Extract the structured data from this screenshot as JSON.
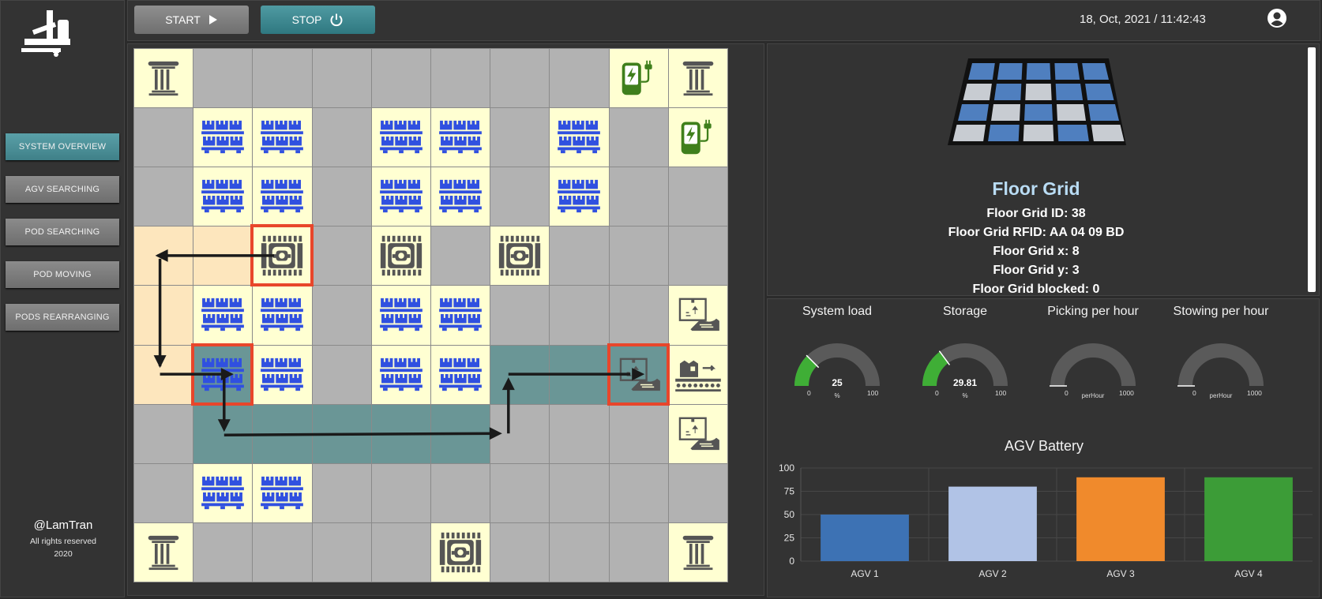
{
  "sidebar": {
    "nav": [
      "SYSTEM OVERVIEW",
      "AGV SEARCHING",
      "POD SEARCHING",
      "POD MOVING",
      "PODS REARRANGING"
    ],
    "active_index": 0,
    "author": "@LamTran",
    "rights": "All rights reserved",
    "year": "2020"
  },
  "topbar": {
    "start_label": "START",
    "stop_label": "STOP",
    "datetime": "18, Oct, 2021 / 11:42:43"
  },
  "floor_grid": {
    "cols": 10,
    "rows": 9,
    "cell_types": [
      [
        "pillar",
        "gray",
        "gray",
        "gray",
        "gray",
        "gray",
        "gray",
        "gray",
        "charger",
        "pillar"
      ],
      [
        "gray",
        "pod",
        "pod",
        "gray",
        "pod",
        "pod",
        "gray",
        "pod",
        "gray",
        "charger"
      ],
      [
        "gray",
        "pod",
        "pod",
        "gray",
        "pod",
        "pod",
        "gray",
        "pod",
        "gray",
        "gray"
      ],
      [
        "path-start",
        "path-start",
        "agv",
        "gray",
        "agv",
        "gray",
        "agv",
        "gray",
        "gray",
        "gray"
      ],
      [
        "path-start",
        "pod",
        "pod",
        "gray",
        "pod",
        "pod",
        "gray",
        "gray",
        "gray",
        "station"
      ],
      [
        "path-start",
        "pod-path",
        "pod",
        "gray",
        "pod",
        "pod",
        "path",
        "path",
        "station-path",
        "conveyor"
      ],
      [
        "gray",
        "path",
        "path",
        "path",
        "path",
        "path",
        "gray",
        "gray",
        "gray",
        "station"
      ],
      [
        "gray",
        "pod",
        "pod",
        "gray",
        "gray",
        "gray",
        "gray",
        "gray",
        "gray",
        "gray"
      ],
      [
        "pillar",
        "gray",
        "gray",
        "gray",
        "gray",
        "agv",
        "gray",
        "gray",
        "gray",
        "pillar"
      ]
    ],
    "highlighted": [
      [
        3,
        2
      ],
      [
        5,
        1
      ],
      [
        5,
        8
      ]
    ]
  },
  "info": {
    "title": "Floor Grid",
    "lines": [
      "Floor Grid ID: 38",
      "Floor Grid RFID: AA 04 09 BD",
      "Floor Grid x: 8",
      "Floor Grid y: 3",
      "Floor Grid blocked: 0"
    ]
  },
  "gauges": [
    {
      "title": "System load",
      "value": 25,
      "display": "25",
      "unit": "%",
      "min": "0",
      "max": "100",
      "color": "#3fae36"
    },
    {
      "title": "Storage",
      "value": 29.81,
      "display": "29.81",
      "unit": "%",
      "min": "0",
      "max": "100",
      "color": "#3fae36"
    },
    {
      "title": "Picking per hour",
      "value": 0,
      "display": "",
      "unit": "perHour",
      "min": "0",
      "max": "1000",
      "color": "#3fae36"
    },
    {
      "title": "Stowing per hour",
      "value": 0,
      "display": "",
      "unit": "perHour",
      "min": "0",
      "max": "1000",
      "color": "#3fae36"
    }
  ],
  "chart_data": {
    "type": "bar",
    "title": "AGV Battery",
    "categories": [
      "AGV 1",
      "AGV 2",
      "AGV 3",
      "AGV 4"
    ],
    "values": [
      50,
      80,
      90,
      90
    ],
    "colors": [
      "#3d72b4",
      "#b1c3e6",
      "#f08a2c",
      "#3c9c37"
    ],
    "ylim": [
      0,
      100
    ],
    "yticks": [
      0,
      25,
      50,
      75,
      100
    ],
    "grid": true,
    "legend": "none"
  }
}
